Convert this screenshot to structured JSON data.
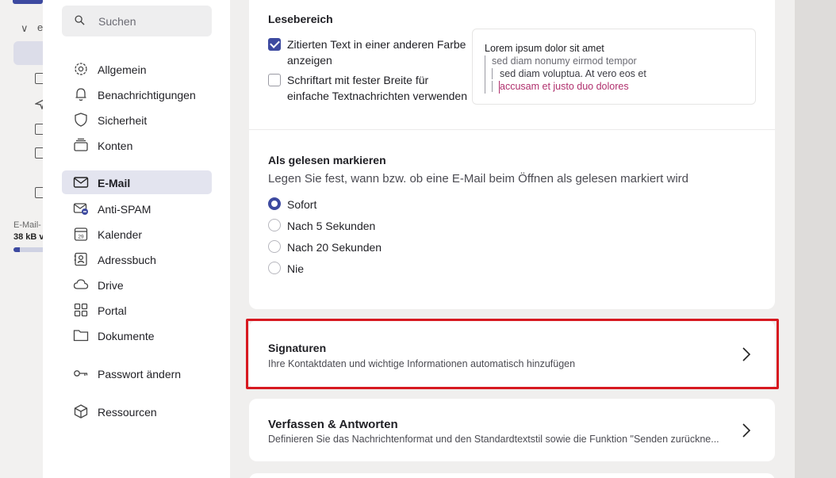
{
  "background_app": {
    "folder_initial": "e",
    "quota_label": "E-Mail-",
    "quota_size": "38 kB v",
    "quota_fraction": 0.2
  },
  "sidebar": {
    "search_placeholder": "Suchen",
    "items": [
      {
        "label": "Allgemein",
        "icon": "gear-icon"
      },
      {
        "label": "Benachrichtigungen",
        "icon": "bell-icon"
      },
      {
        "label": "Sicherheit",
        "icon": "shield-icon"
      },
      {
        "label": "Konten",
        "icon": "accounts-icon"
      },
      {
        "label": "E-Mail",
        "icon": "mail-icon",
        "selected": true
      },
      {
        "label": "Anti-SPAM",
        "icon": "spam-mail-icon"
      },
      {
        "label": "Kalender",
        "icon": "calendar-icon"
      },
      {
        "label": "Adressbuch",
        "icon": "addressbook-icon"
      },
      {
        "label": "Drive",
        "icon": "cloud-icon"
      },
      {
        "label": "Portal",
        "icon": "grid-icon"
      },
      {
        "label": "Dokumente",
        "icon": "folder-icon"
      },
      {
        "label": "Passwort ändern",
        "icon": "key-icon"
      },
      {
        "label": "Ressourcen",
        "icon": "cube-icon"
      }
    ],
    "calendar_day": "29"
  },
  "reading": {
    "title": "Lesebereich",
    "option1_line1": "Zitierten Text in einer anderen Farbe",
    "option1_line2": "anzeigen",
    "option1_checked": true,
    "option2_line1": "Schriftart mit fester Breite für",
    "option2_line2": "einfache Textnachrichten verwenden",
    "option2_checked": false,
    "preview": {
      "line1": "Lorem ipsum dolor sit amet",
      "line2": "sed diam nonumy eirmod tempor",
      "line3": "sed diam voluptua. At vero eos et",
      "line4": "accusam et justo duo dolores"
    }
  },
  "mark_read": {
    "title": "Als gelesen markieren",
    "description": "Legen Sie fest, wann bzw. ob eine E-Mail beim Öffnen als gelesen markiert wird",
    "options": [
      "Sofort",
      "Nach 5 Sekunden",
      "Nach 20 Sekunden",
      "Nie"
    ],
    "selected": "Sofort"
  },
  "signatures": {
    "title": "Signaturen",
    "subtitle": "Ihre Kontaktdaten und wichtige Informationen automatisch hinzufügen"
  },
  "compose": {
    "title": "Verfassen & Antworten",
    "subtitle": "Definieren Sie das Nachrichtenformat und den Standardtextstil sowie die Funktion \"Senden zurückne..."
  },
  "colors": {
    "accent": "#3d4aa0",
    "quote_color": "#b0306d",
    "highlight": "#d71920"
  }
}
